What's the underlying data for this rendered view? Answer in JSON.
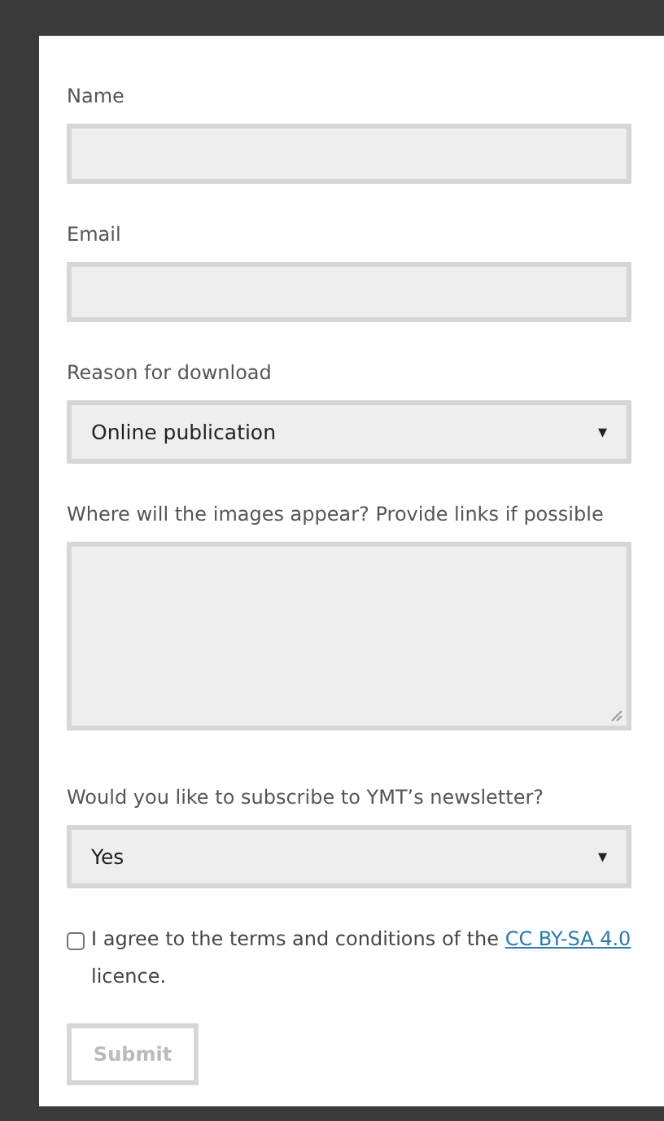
{
  "form": {
    "fields": [
      {
        "kind": "text",
        "label": "Name"
      },
      {
        "kind": "text",
        "label": "Email"
      },
      {
        "kind": "select",
        "label": "Reason for download",
        "value": "Online publication",
        "caret": "▾"
      },
      {
        "kind": "textarea",
        "label": "Where will the images appear? Provide links if possible"
      },
      {
        "kind": "select",
        "label": "Would you like to subscribe to YMT’s newsletter?",
        "value": "Yes",
        "caret": "▾"
      }
    ],
    "agreement": {
      "checked": false,
      "text_before": "I agree to the terms and conditions of the",
      "link": "CC BY-SA 4.0",
      "text_after": "licence."
    },
    "submit": {
      "label": "Submit",
      "disabled": true
    }
  }
}
